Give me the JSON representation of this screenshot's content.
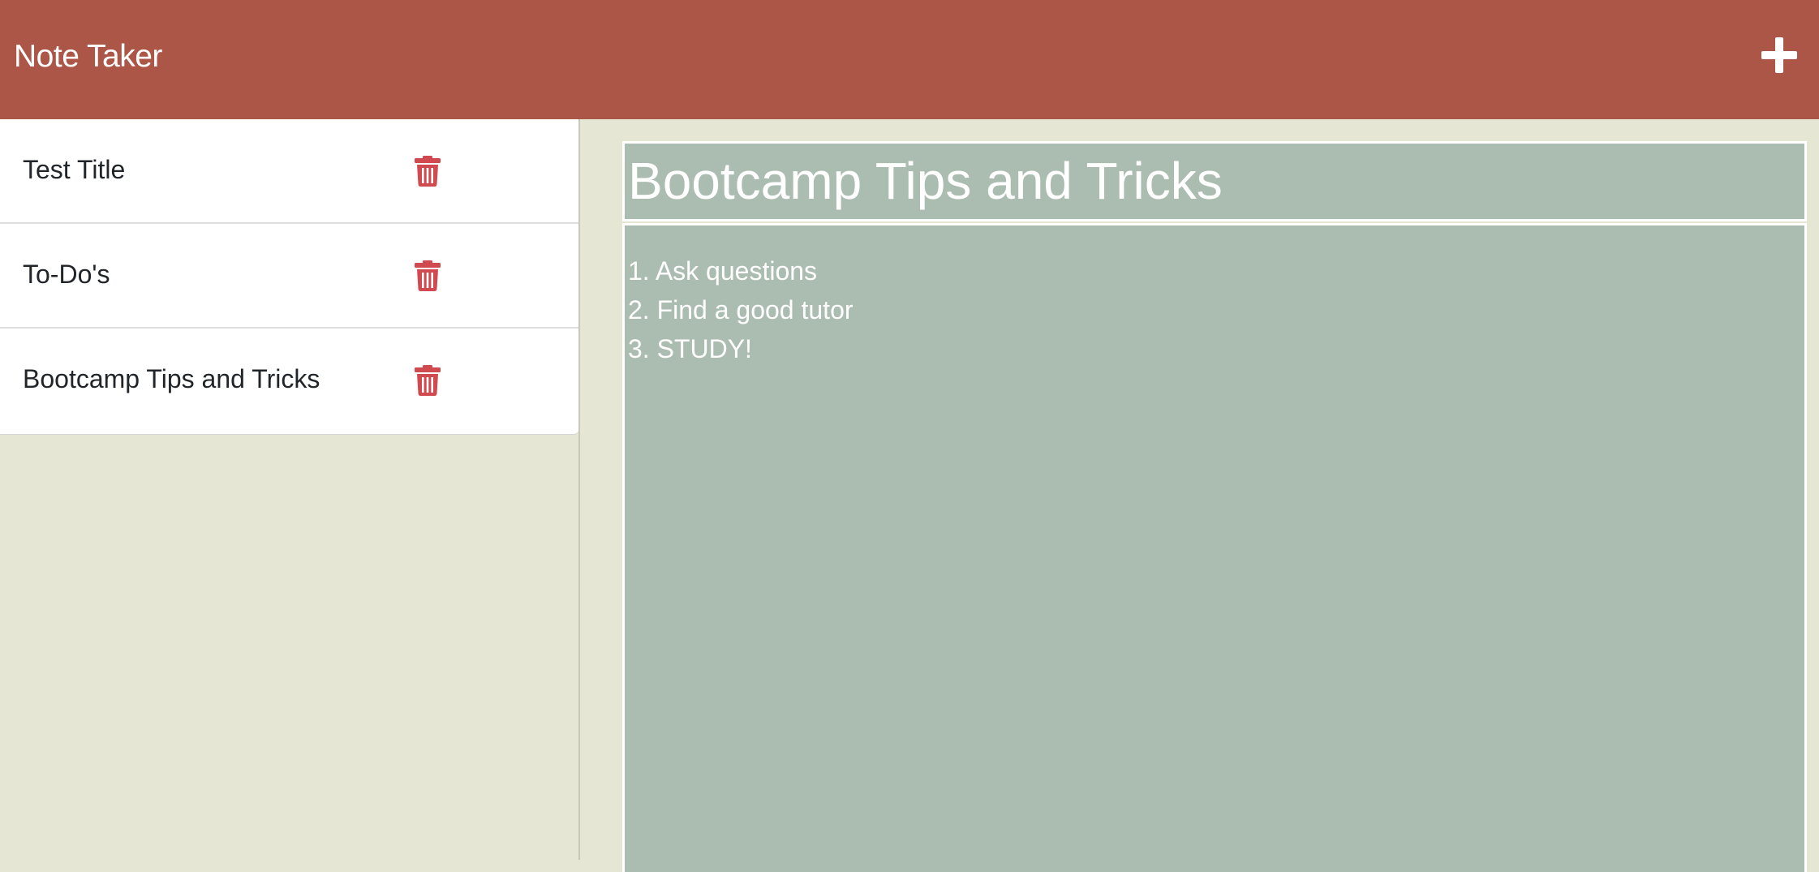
{
  "navbar": {
    "brand": "Note Taker",
    "new_note_icon": "plus-icon"
  },
  "sidebar": {
    "notes": [
      {
        "title": "Test Title",
        "delete_icon": "trash-icon"
      },
      {
        "title": "To-Do's",
        "delete_icon": "trash-icon"
      },
      {
        "title": "Bootcamp Tips and Tricks",
        "delete_icon": "trash-icon"
      }
    ]
  },
  "editor": {
    "title": "Bootcamp Tips and Tricks",
    "body_lines": [
      "1. Ask questions",
      "2. Find a good tutor",
      "3. STUDY!"
    ]
  },
  "colors": {
    "navbar_bg": "#ac5648",
    "page_bg": "#e5e6d4",
    "editor_field_bg": "#abbdb0",
    "delete_icon": "#d04a4f"
  }
}
